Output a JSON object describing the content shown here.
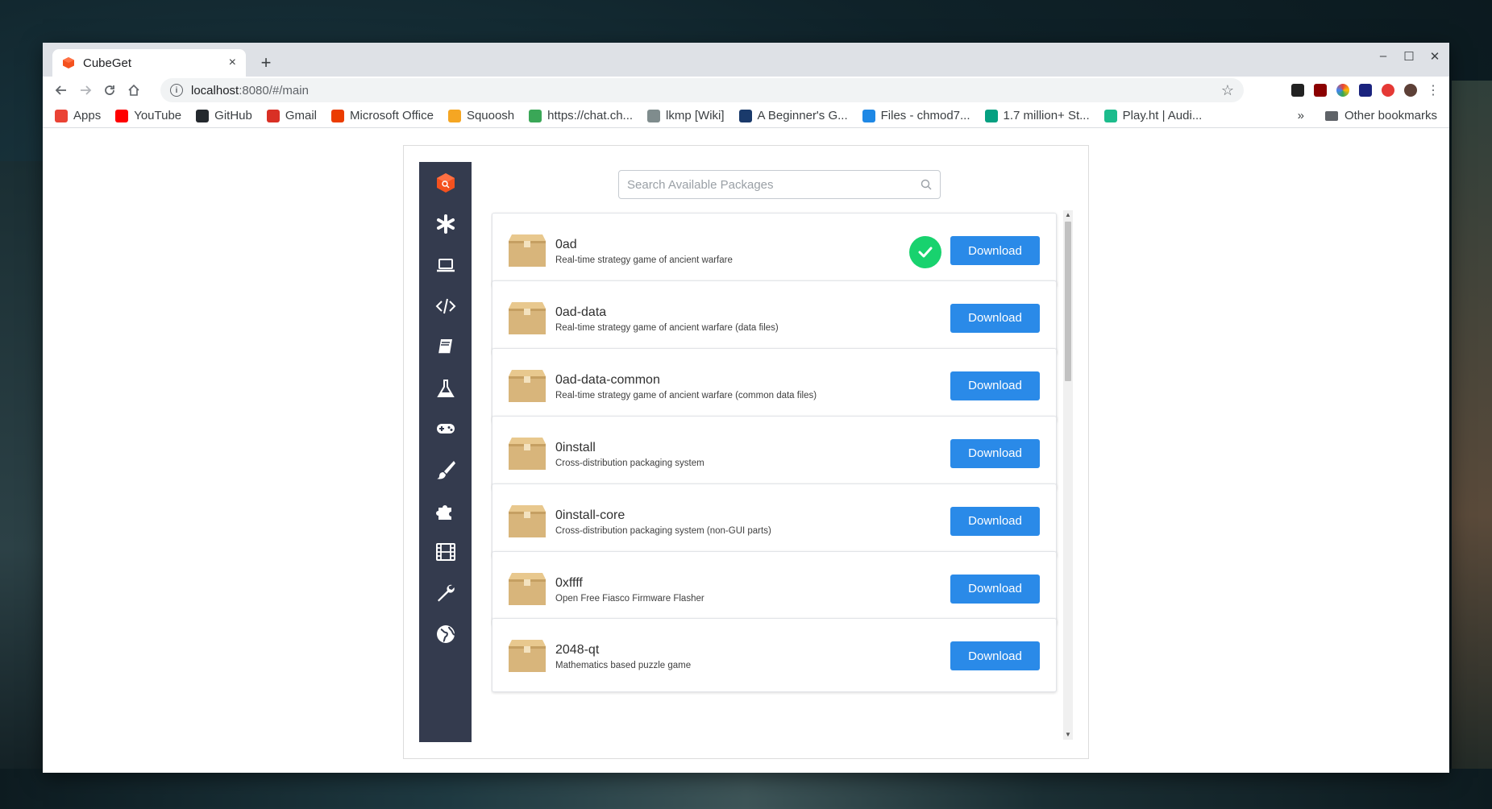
{
  "browser": {
    "tab_title": "CubeGet",
    "tab_close": "×",
    "new_tab": "+",
    "url_host": "localhost",
    "url_rest": ":8080/#/main",
    "bookmarks": [
      {
        "label": "Apps",
        "color": "#ea4335"
      },
      {
        "label": "YouTube",
        "color": "#ff0000"
      },
      {
        "label": "GitHub",
        "color": "#24292e"
      },
      {
        "label": "Gmail",
        "color": "#d93025"
      },
      {
        "label": "Microsoft Office",
        "color": "#eb3c00"
      },
      {
        "label": "Squoosh",
        "color": "#f5a623"
      },
      {
        "label": "https://chat.ch...",
        "color": "#3aa757"
      },
      {
        "label": "lkmp [Wiki]",
        "color": "#7f8c8d"
      },
      {
        "label": "A Beginner's G...",
        "color": "#1a3a6b"
      },
      {
        "label": "Files - chmod7...",
        "color": "#1e88e5"
      },
      {
        "label": "1.7 million+ St...",
        "color": "#05a081"
      },
      {
        "label": "Play.ht | Audi...",
        "color": "#1cbc8c"
      }
    ],
    "bookmarks_more": "»",
    "other_bookmarks": "Other bookmarks"
  },
  "app": {
    "accent": "#2a8ae8",
    "sidebar_color": "#343b4e",
    "search_placeholder": "Search Available Packages",
    "sidebar_items": [
      {
        "icon": "cube-logo-icon"
      },
      {
        "icon": "asterisk-icon"
      },
      {
        "icon": "laptop-icon"
      },
      {
        "icon": "code-icon"
      },
      {
        "icon": "book-icon"
      },
      {
        "icon": "flask-icon"
      },
      {
        "icon": "gamepad-icon"
      },
      {
        "icon": "paintbrush-icon"
      },
      {
        "icon": "puzzle-icon"
      },
      {
        "icon": "film-icon"
      },
      {
        "icon": "wrench-icon"
      },
      {
        "icon": "globe-icon"
      }
    ],
    "download_label": "Download",
    "packages": [
      {
        "name": "0ad",
        "description": "Real-time strategy game of ancient warfare",
        "installed": true
      },
      {
        "name": "0ad-data",
        "description": "Real-time strategy game of ancient warfare (data files)",
        "installed": false
      },
      {
        "name": "0ad-data-common",
        "description": "Real-time strategy game of ancient warfare (common data files)",
        "installed": false
      },
      {
        "name": "0install",
        "description": "Cross-distribution packaging system",
        "installed": false
      },
      {
        "name": "0install-core",
        "description": "Cross-distribution packaging system (non-GUI parts)",
        "installed": false
      },
      {
        "name": "0xffff",
        "description": "Open Free Fiasco Firmware Flasher",
        "installed": false
      },
      {
        "name": "2048-qt",
        "description": "Mathematics based puzzle game",
        "installed": false
      }
    ]
  }
}
